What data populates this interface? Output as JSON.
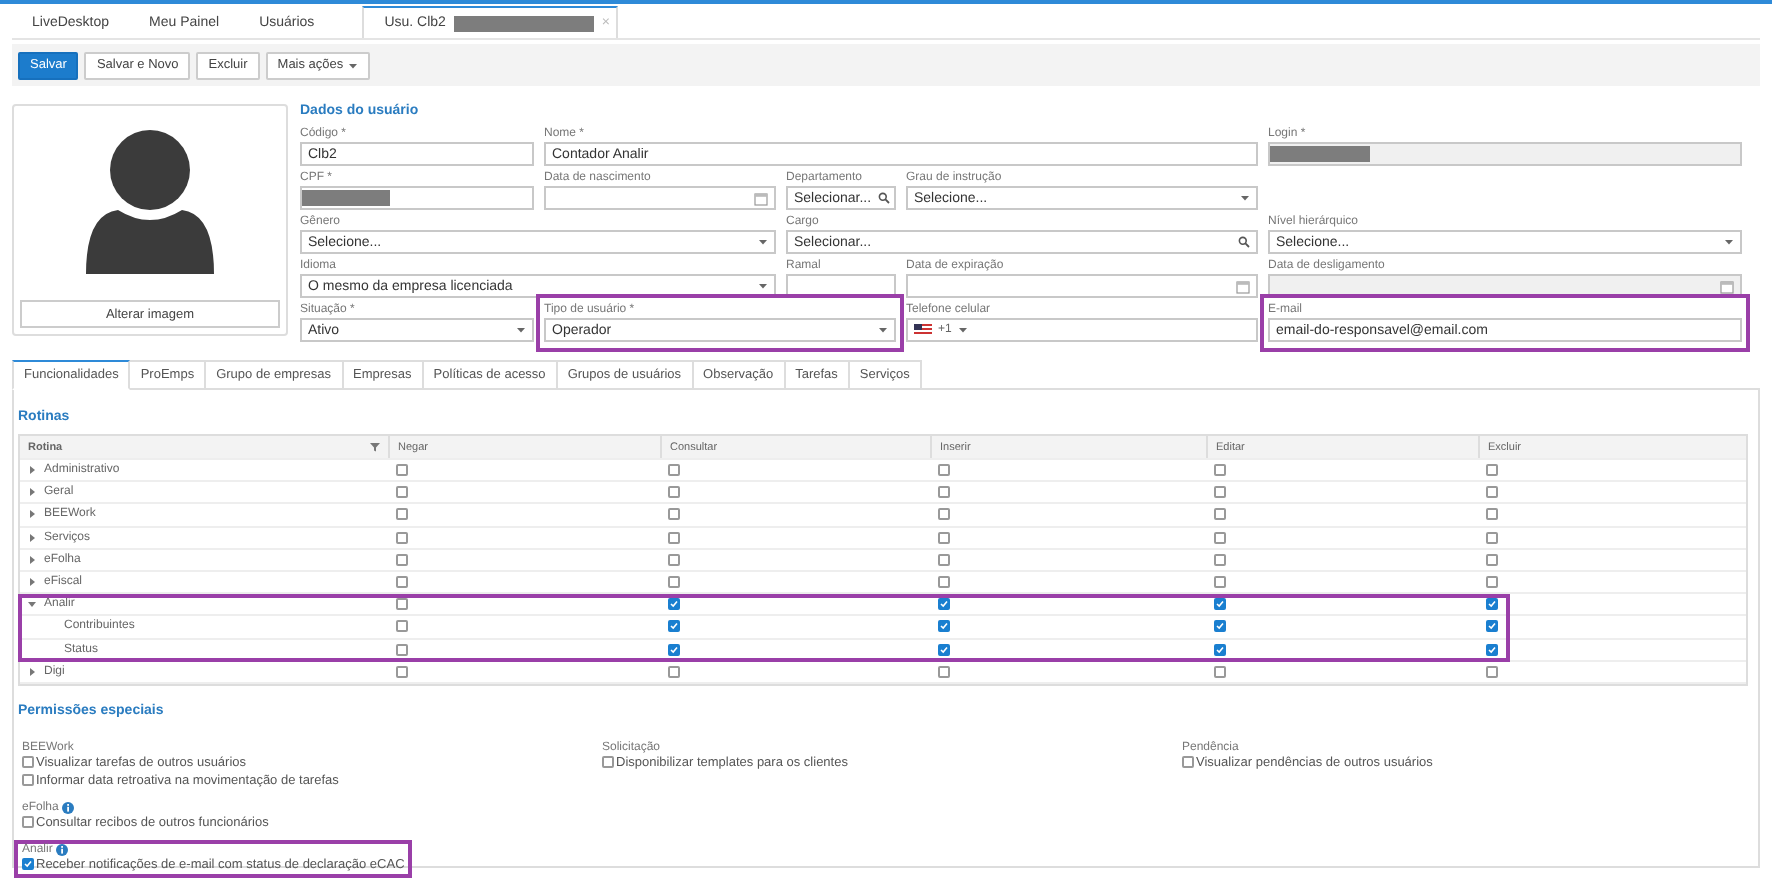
{
  "top_tabs": [
    {
      "label": "LiveDesktop",
      "selected": false,
      "redacted": false,
      "closable": false
    },
    {
      "label": "Meu Painel",
      "selected": false,
      "redacted": false,
      "closable": false
    },
    {
      "label": "Usuários",
      "selected": false,
      "redacted": false,
      "closable": false
    },
    {
      "label": "Usu. Clb2",
      "selected": true,
      "redacted": true,
      "closable": true,
      "close": "×"
    }
  ],
  "toolbar": [
    {
      "label": "Salvar",
      "primary": true,
      "menu": false
    },
    {
      "label": "Salvar e Novo",
      "primary": false,
      "menu": false
    },
    {
      "label": "Excluir",
      "primary": false,
      "menu": false
    },
    {
      "label": "Mais ações",
      "primary": false,
      "menu": true
    }
  ],
  "photo": {
    "button": "Alterar imagem"
  },
  "form_title": "Dados do usuário",
  "fields": [
    {
      "label": "Código *",
      "kind": "text",
      "value": "Clb2",
      "disabled": false,
      "redacted": false,
      "highlighted": false
    },
    {
      "label": "Nome *",
      "kind": "text",
      "value": "Contador Analir",
      "disabled": false,
      "redacted": false,
      "highlighted": false
    },
    {
      "label": "Login *",
      "kind": "text",
      "disabled": true,
      "redacted": true,
      "highlighted": false
    },
    {
      "label": "CPF *",
      "kind": "text",
      "disabled": false,
      "redacted": true,
      "highlighted": false
    },
    {
      "label": "Data de nascimento",
      "kind": "date",
      "disabled": false,
      "redacted": false,
      "highlighted": false
    },
    {
      "label": "Departamento",
      "kind": "lookup",
      "value": "Selecionar...",
      "disabled": false,
      "redacted": false,
      "highlighted": false
    },
    {
      "label": "Grau de instrução",
      "kind": "select",
      "value": "Selecione...",
      "disabled": false,
      "redacted": false,
      "highlighted": false
    },
    {
      "label": "Gênero",
      "kind": "select",
      "value": "Selecione...",
      "disabled": false,
      "redacted": false,
      "highlighted": false
    },
    {
      "label": "Cargo",
      "kind": "lookup",
      "value": "Selecionar...",
      "disabled": false,
      "redacted": false,
      "highlighted": false
    },
    {
      "label": "Nível hierárquico",
      "kind": "select",
      "value": "Selecione...",
      "disabled": false,
      "redacted": false,
      "highlighted": false
    },
    {
      "label": "Idioma",
      "kind": "select",
      "value": "O mesmo da empresa licenciada",
      "disabled": false,
      "redacted": false,
      "highlighted": false
    },
    {
      "label": "Ramal",
      "kind": "text",
      "disabled": false,
      "redacted": false,
      "highlighted": false
    },
    {
      "label": "Data de expiração",
      "kind": "date",
      "disabled": false,
      "redacted": false,
      "highlighted": false
    },
    {
      "label": "Data de desligamento",
      "kind": "date",
      "disabled": true,
      "redacted": false,
      "highlighted": false
    },
    {
      "label": "Situação *",
      "kind": "select",
      "value": "Ativo",
      "disabled": false,
      "redacted": false,
      "highlighted": false
    },
    {
      "label": "Tipo de usuário *",
      "kind": "select",
      "value": "Operador",
      "disabled": false,
      "redacted": false,
      "highlighted": true
    },
    {
      "label": "Telefone celular",
      "kind": "phone",
      "dial_code": "+1",
      "disabled": false,
      "redacted": false,
      "highlighted": false
    },
    {
      "label": "E-mail",
      "kind": "text",
      "value": "email-do-responsavel@email.com",
      "disabled": false,
      "redacted": false,
      "highlighted": true
    }
  ],
  "section_tabs": [
    {
      "label": "Funcionalidades",
      "selected": true
    },
    {
      "label": "ProEmps",
      "selected": false
    },
    {
      "label": "Grupo de empresas",
      "selected": false
    },
    {
      "label": "Empresas",
      "selected": false
    },
    {
      "label": "Políticas de acesso",
      "selected": false
    },
    {
      "label": "Grupos de usuários",
      "selected": false
    },
    {
      "label": "Observação",
      "selected": false
    },
    {
      "label": "Tarefas",
      "selected": false
    },
    {
      "label": "Serviços",
      "selected": false
    }
  ],
  "routines": {
    "title": "Rotinas",
    "columns": [
      "Rotina",
      "Negar",
      "Consultar",
      "Inserir",
      "Editar",
      "Excluir"
    ],
    "rows": [
      {
        "label": "Administrativo",
        "expanded": false,
        "highlighted": false,
        "checks": [
          false,
          false,
          false,
          false,
          false
        ]
      },
      {
        "label": "Geral",
        "expanded": false,
        "highlighted": false,
        "checks": [
          false,
          false,
          false,
          false,
          false
        ]
      },
      {
        "label": "BEEWork",
        "expanded": false,
        "highlighted": false,
        "checks": [
          false,
          false,
          false,
          false,
          false
        ]
      },
      {
        "label": "Serviços",
        "expanded": false,
        "highlighted": false,
        "checks": [
          false,
          false,
          false,
          false,
          false
        ]
      },
      {
        "label": "eFolha",
        "expanded": false,
        "highlighted": false,
        "checks": [
          false,
          false,
          false,
          false,
          false
        ]
      },
      {
        "label": "eFiscal",
        "expanded": false,
        "highlighted": false,
        "checks": [
          false,
          false,
          false,
          false,
          false
        ]
      },
      {
        "label": "Analir",
        "expanded": true,
        "highlighted": true,
        "checks": [
          false,
          true,
          true,
          true,
          true
        ],
        "children": [
          {
            "label": "Contribuintes",
            "checks": [
              false,
              true,
              true,
              true,
              true
            ]
          },
          {
            "label": "Status",
            "checks": [
              false,
              true,
              true,
              true,
              true
            ]
          }
        ]
      },
      {
        "label": "Digi",
        "expanded": false,
        "highlighted": false,
        "checks": [
          false,
          false,
          false,
          false,
          false
        ]
      }
    ]
  },
  "special_permissions": {
    "title": "Permissões especiais",
    "columns": [
      [
        {
          "title": "BEEWork",
          "info": false,
          "highlighted": false,
          "options": [
            {
              "label": "Visualizar tarefas de outros usuários",
              "checked": false
            },
            {
              "label": "Informar data retroativa na movimentação de tarefas",
              "checked": false
            }
          ]
        },
        {
          "title": "eFolha",
          "info": true,
          "highlighted": false,
          "options": [
            {
              "label": "Consultar recibos de outros funcionários",
              "checked": false
            }
          ]
        },
        {
          "title": "Analir",
          "info": true,
          "highlighted": true,
          "options": [
            {
              "label": "Receber notificações de e-mail com status de declaração eCAC",
              "checked": true
            }
          ]
        }
      ],
      [
        {
          "title": "Solicitação",
          "info": false,
          "highlighted": false,
          "options": [
            {
              "label": "Disponibilizar templates para os clientes",
              "checked": false
            }
          ]
        }
      ],
      [
        {
          "title": "Pendência",
          "info": false,
          "highlighted": false,
          "options": [
            {
              "label": "Visualizar pendências de outros usuários",
              "checked": false
            }
          ]
        }
      ]
    ]
  }
}
